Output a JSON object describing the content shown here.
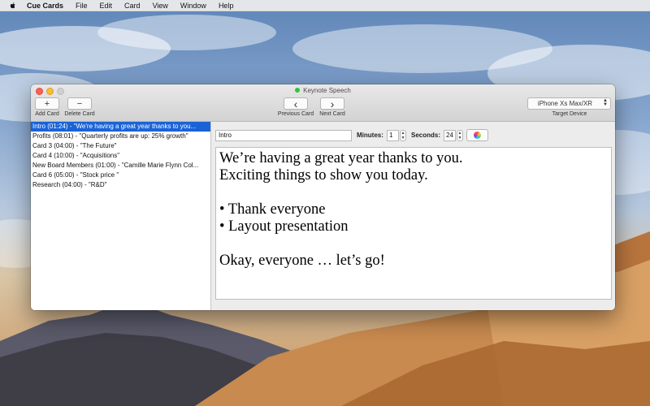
{
  "menubar": {
    "app_name": "Cue Cards",
    "items": [
      "File",
      "Edit",
      "Card",
      "View",
      "Window",
      "Help"
    ]
  },
  "window": {
    "title": "Keynote Speech",
    "toolbar": {
      "add_symbol": "+",
      "add_label": "Add Card",
      "delete_symbol": "−",
      "delete_label": "Delete Card",
      "prev_symbol": "‹",
      "prev_label": "Previous Card",
      "next_symbol": "›",
      "next_label": "Next Card",
      "device_value": "iPhone Xs Max/XR",
      "device_label": "Target Device"
    }
  },
  "cards": [
    "Intro (01:24) - \"We're having a great year thanks to you...",
    "Profits (08:01) - \"Quarterly profits are up: 25% growth\"",
    "Card 3 (04:00) - \"The Future\"",
    "Card 4 (10:00) - \"Acquisitions\"",
    "New Board Members (01:00) - \"Camille Marie Flynn Col...",
    "Card 6 (05:00) - \"Stock price \"",
    "Research (04:00) - \"R&D\""
  ],
  "editor": {
    "card_name": "Intro",
    "minutes_label": "Minutes:",
    "minutes_value": "1",
    "seconds_label": "Seconds:",
    "seconds_value": "24",
    "text_lines": [
      "We’re having a great year thanks to you.",
      "Exciting things to show you today.",
      "",
      "• Thank everyone",
      "• Layout presentation",
      "",
      "Okay, everyone … let’s go!"
    ]
  },
  "colors": {
    "selection": "#1a63d6",
    "close": "#fc5f57",
    "minimize": "#fdbc2e",
    "document_dot": "#2fc441"
  },
  "icons": [
    "apple-icon",
    "plus-icon",
    "minus-icon",
    "chevron-left-icon",
    "chevron-right-icon",
    "chevron-updown-icon",
    "color-wheel-icon"
  ]
}
